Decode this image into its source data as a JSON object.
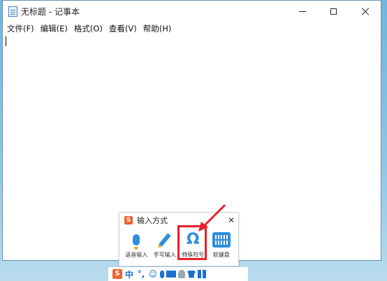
{
  "window": {
    "title": "无标题 - 记事本",
    "menu": [
      "文件(F)",
      "编辑(E)",
      "格式(O)",
      "查看(V)",
      "帮助(H)"
    ]
  },
  "ime_panel": {
    "title": "输入方式",
    "tools": [
      {
        "label": "语音输入",
        "icon": "microphone-icon"
      },
      {
        "label": "手写输入",
        "icon": "pen-icon"
      },
      {
        "label": "特殊符号",
        "icon": "omega-icon",
        "highlighted": true
      },
      {
        "label": "软键盘",
        "icon": "keyboard-icon"
      }
    ],
    "highlight_color": "#e8202a"
  },
  "ime_bar": {
    "logo": "S",
    "mode": "中",
    "punct": "°,",
    "emoji": "☺"
  }
}
